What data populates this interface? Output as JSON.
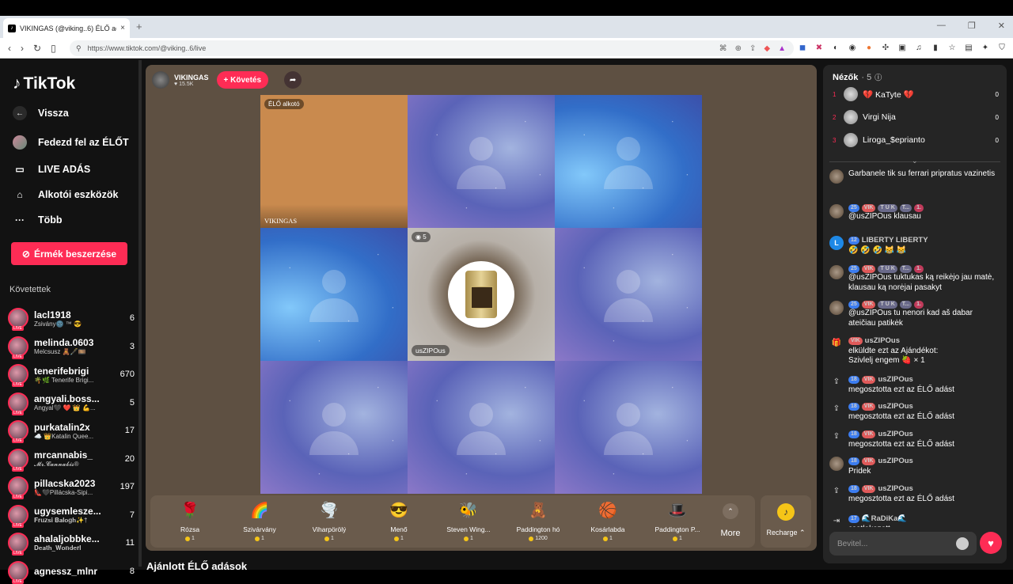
{
  "browser": {
    "tab_title": "VIKINGAS (@viking..6) ÉLŐ adás",
    "url": "https://www.tiktok.com/@viking..6/live",
    "new_tab": "+",
    "close_tab": "×"
  },
  "sidebar": {
    "logo": "TikTok",
    "back": "Vissza",
    "explore_live": "Fedezd fel az ÉLŐT",
    "live_adas": "LIVE ADÁS",
    "creator_tools": "Alkotói eszközök",
    "more": "Több",
    "coins_button": "Érmék beszerzése",
    "following_header": "Követettek",
    "following": [
      {
        "name": "lacl1918",
        "sub": "Zsivány🌚 ™ 😎",
        "count": "6"
      },
      {
        "name": "melinda.0603",
        "sub": "Melcsusz 🧸🖋️🎞️",
        "count": "3"
      },
      {
        "name": "tenerifebrigi",
        "sub": "🌴🌿 Tenerife Brigi...",
        "count": "670"
      },
      {
        "name": "angyali.boss...",
        "sub": "Angyal🖤 ❤️ 👑 💪...",
        "count": "5"
      },
      {
        "name": "purkatalin2x",
        "sub": "☁️ 👑Katalin Quee...",
        "count": "17"
      },
      {
        "name": "mrcannabis_",
        "sub": "𝓜𝓻.𝓒𝓪𝓷𝓷𝓪𝓫𝓲𝓼®",
        "count": "20"
      },
      {
        "name": "pillacska2023",
        "sub": "👠🖤Pillácska-Sipi...",
        "count": "197"
      },
      {
        "name": "ugysemlesze...",
        "sub": "𝐅𝐫𝐮𝐳𝐬𝐢 𝐁𝐚𝐥𝐨𝐠𝐡✨†",
        "count": "7"
      },
      {
        "name": "ahalaljobbke...",
        "sub": "𝐃𝐞𝐚𝐭𝐡_𝐖𝐨𝐧𝐝𝐞𝐫𝐥",
        "count": "11"
      },
      {
        "name": "agnessz_mlnr",
        "sub": "",
        "count": "8"
      }
    ]
  },
  "stream": {
    "host_name": "VIKINGAS",
    "host_likes": "♥ 15.5K",
    "follow_button": "+ Követés",
    "host_tag": "ÉLŐ alkotó",
    "host_cell_name": "VIKINGAS",
    "center_viewers": "5",
    "center_name": "usZIPOus"
  },
  "gifts": [
    {
      "icon": "🌹",
      "label": "Rózsa",
      "price": "1"
    },
    {
      "icon": "🌈",
      "label": "Szivárvány",
      "price": "1"
    },
    {
      "icon": "🌪️",
      "label": "Viharpörölý",
      "price": "1"
    },
    {
      "icon": "😎",
      "label": "Menő",
      "price": "1"
    },
    {
      "icon": "🐝",
      "label": "Steven Wing...",
      "price": "1"
    },
    {
      "icon": "🧸",
      "label": "Paddington hó",
      "price": "1200"
    },
    {
      "icon": "🏀",
      "label": "Kosárlabda",
      "price": "1"
    },
    {
      "icon": "🎩",
      "label": "Paddington P...",
      "price": "1"
    }
  ],
  "more_label": "More",
  "recharge_label": "Recharge ⌃",
  "recommended_title": "Ajánlott ÉLŐ adások",
  "chat": {
    "viewers_title": "Nézők",
    "viewers_count": "· 5",
    "top_viewers": [
      {
        "rank": "1",
        "name": "💔 KaTyte 💔",
        "score": "0"
      },
      {
        "rank": "2",
        "name": "Virgi Nija",
        "score": "0"
      },
      {
        "rank": "3",
        "name": "Liroga_$eprianto",
        "score": "0"
      }
    ],
    "messages": [
      {
        "text": "Garbanele tik su ferrari pripratus vazinetis"
      },
      {
        "badges": [
          "25",
          "VIK",
          "T U K",
          "T...",
          "1."
        ],
        "text": "@usZIPOus klausau"
      },
      {
        "avatar": "L",
        "badges": [
          "12"
        ],
        "user": "LIBERTY LIBERTY",
        "text": "🤣 🤣 🤣 😹 😹"
      },
      {
        "badges": [
          "25",
          "VIK",
          "T U K",
          "T...",
          "1."
        ],
        "text": "@usZIPOus tuktukas ką reikėjo jau matė, klausau ką norėjai pasakyt"
      },
      {
        "badges": [
          "25",
          "VIK",
          "T U K",
          "T...",
          "1."
        ],
        "text": "@usZIPOus tu nenori kad aš dabar ateičiau patikėk"
      },
      {
        "badges": [
          "VIK"
        ],
        "user": "usZIPOus",
        "text": "elküldte ezt az Ajándékot:",
        "text2": "Szivlelj engem 🍓 × 1"
      },
      {
        "badges": [
          "18",
          "VIK"
        ],
        "user": "usZIPOus",
        "text": "megosztotta ezt az ÉLŐ adást"
      },
      {
        "badges": [
          "18",
          "VIK"
        ],
        "user": "usZIPOus",
        "text": "megosztotta ezt az ÉLŐ adást"
      },
      {
        "badges": [
          "18",
          "VIK"
        ],
        "user": "usZIPOus",
        "text": "megosztotta ezt az ÉLŐ adást"
      },
      {
        "badges": [
          "18",
          "VIK"
        ],
        "user": "usZIPOus",
        "text": "Pridek"
      },
      {
        "badges": [
          "18",
          "VIK"
        ],
        "user": "usZIPOus",
        "text": "megosztotta ezt az ÉLŐ adást"
      },
      {
        "badges": [
          "17"
        ],
        "user": "🌊RaDiKa🌊",
        "text": "csatlakozott"
      }
    ],
    "input_placeholder": "Bevitel..."
  }
}
